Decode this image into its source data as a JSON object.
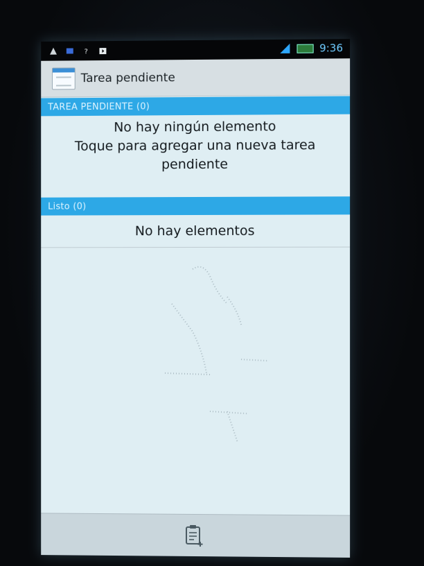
{
  "status_bar": {
    "time": "9:36"
  },
  "action_bar": {
    "title": "Tarea pendiente"
  },
  "pending_section": {
    "header": "TAREA PENDIENTE (0)",
    "empty_lines": [
      "No hay ningún elemento",
      "Toque para agregar una nueva tarea",
      "pendiente"
    ]
  },
  "done_section": {
    "header": "Listo (0)",
    "empty_text": "No hay elementos"
  },
  "bottom_bar": {
    "add_icon": "clipboard-add-icon"
  },
  "colors": {
    "accent": "#2da8e6",
    "screen_bg": "#dfeef3",
    "status_text": "#6fcbff"
  }
}
